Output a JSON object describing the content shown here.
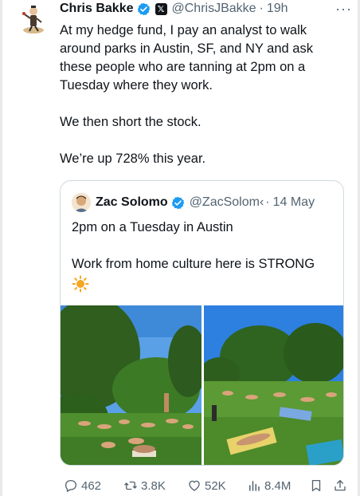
{
  "tweet": {
    "author_name": "Chris Bakke",
    "author_handle": "@ChrisJBakke",
    "time": "19h",
    "paragraphs": [
      "At my hedge fund, I pay an analyst to walk around parks in Austin, SF, and NY and ask these people who are tanning at 2pm on a Tuesday where they work.",
      "We then short the stock.",
      "We’re up 728% this year."
    ],
    "more_label": "···"
  },
  "quote": {
    "author_name": "Zac Solomo",
    "author_handle": "@ZacSolom‹",
    "date": "14 May",
    "paragraphs": [
      "2pm on a Tuesday in Austin",
      "Work from home culture here is STRONG"
    ],
    "emoji": "☀️",
    "photos": [
      "park-photo-1",
      "park-photo-2"
    ]
  },
  "actions": {
    "replies": "462",
    "reposts": "3.8K",
    "likes": "52K",
    "views": "8.4M"
  },
  "colors": {
    "text": "#0f1419",
    "muted": "#536471",
    "verified": "#1d9bf0",
    "border": "#cfd9de"
  }
}
